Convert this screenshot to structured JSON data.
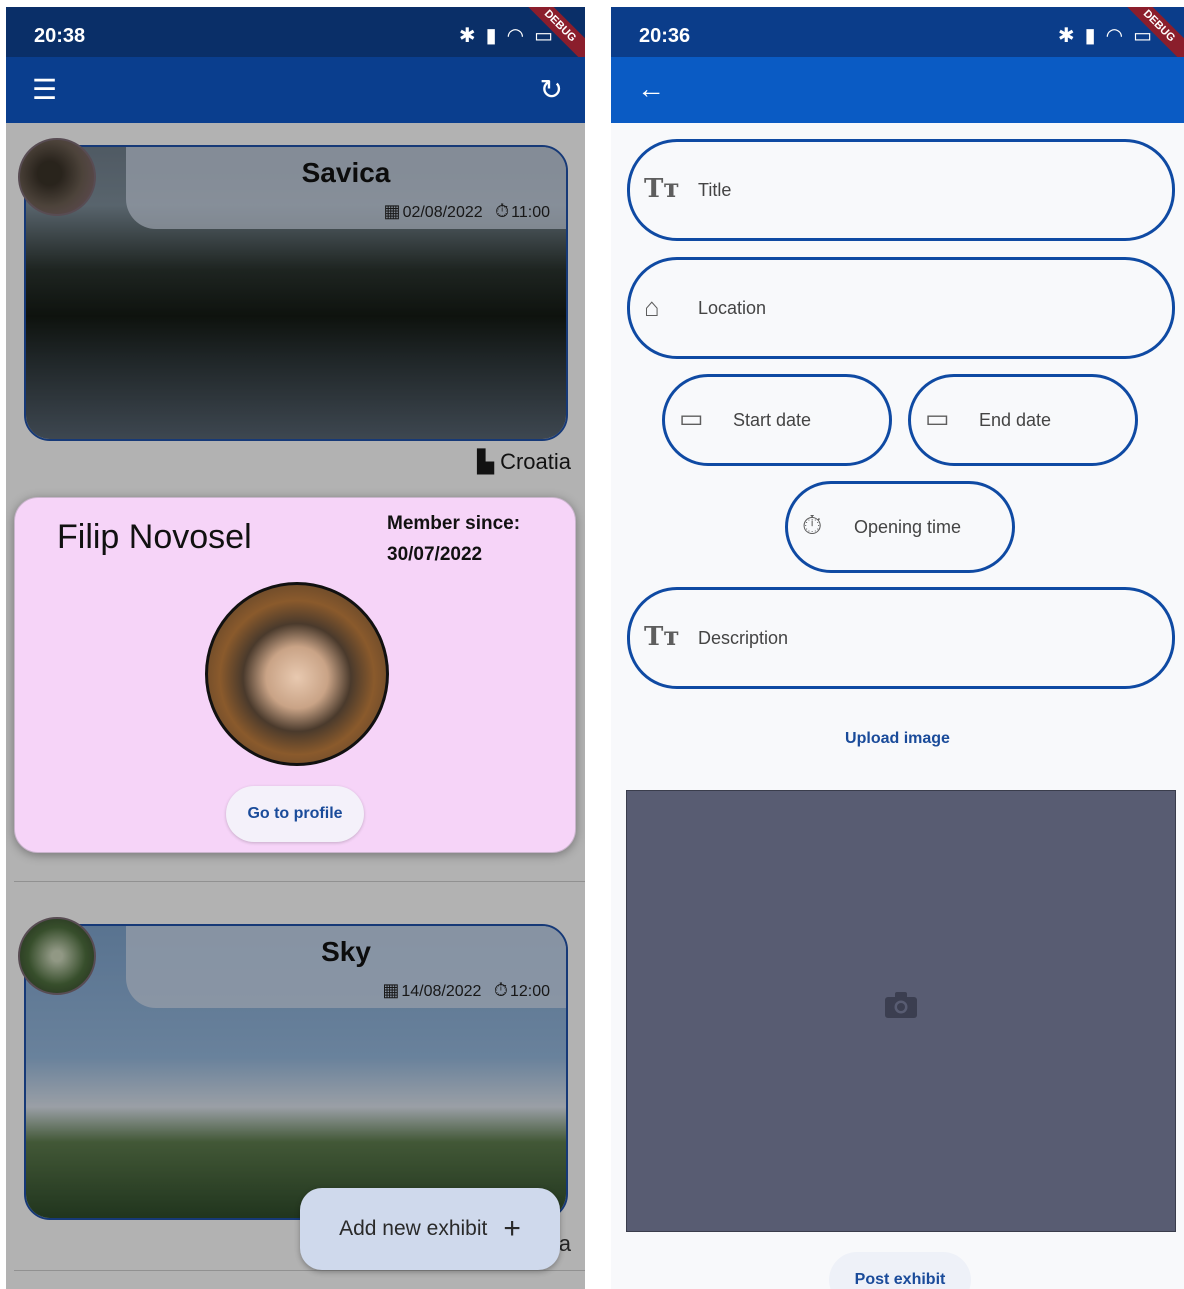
{
  "left": {
    "status": {
      "time": "20:38"
    },
    "debug_banner": "DEBUG",
    "cards": [
      {
        "title": "Savica",
        "date": "02/08/2022",
        "time": "11:00",
        "location": "Croatia"
      },
      {
        "title": "Sky",
        "date": "14/08/2022",
        "time": "12:00",
        "location": "Croatia"
      }
    ],
    "popup": {
      "name": "Filip Novosel",
      "member_label": "Member since:",
      "member_date": "30/07/2022",
      "button": "Go to profile"
    },
    "fab": {
      "label": "Add new exhibit"
    },
    "peek": "a"
  },
  "right": {
    "status": {
      "time": "20:36"
    },
    "debug_banner": "DEBUG",
    "fields": {
      "title": "Title",
      "location": "Location",
      "start_date": "Start date",
      "end_date": "End date",
      "opening_time": "Opening time",
      "description": "Description"
    },
    "upload_label": "Upload image",
    "post_button": "Post exhibit"
  },
  "colors": {
    "primary": "#0a5bc4",
    "outline": "#0f4aa3",
    "popup_bg": "#f6d4f8",
    "image_placeholder": "#585c72"
  }
}
